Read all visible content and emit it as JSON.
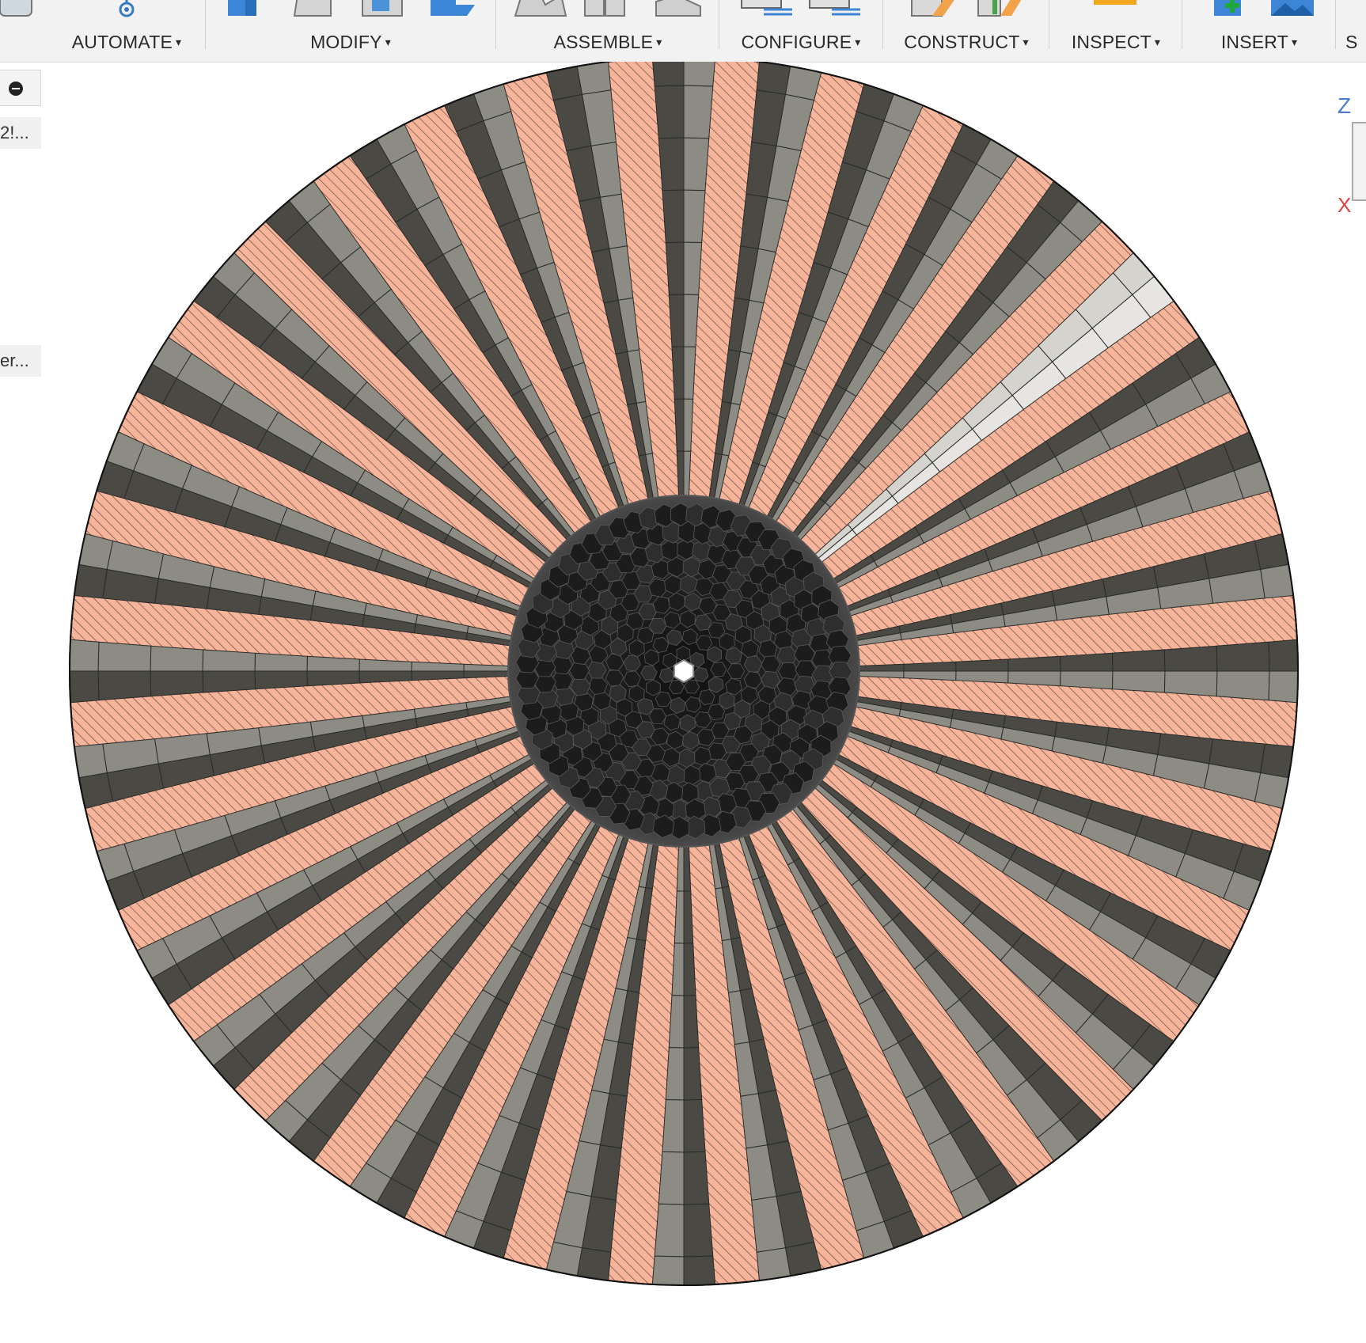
{
  "toolbar": {
    "groups": [
      {
        "label": "AUTOMATE"
      },
      {
        "label": "MODIFY"
      },
      {
        "label": "ASSEMBLE"
      },
      {
        "label": "CONFIGURE"
      },
      {
        "label": "CONSTRUCT"
      },
      {
        "label": "INSPECT"
      },
      {
        "label": "INSERT"
      },
      {
        "label": "S"
      }
    ],
    "caret": "▾"
  },
  "side_panel": {
    "tab1_text": "2!...",
    "tab2_text": "er..."
  },
  "viewcube": {
    "axis_z": "Z",
    "axis_x": "X"
  },
  "model": {
    "colors": {
      "section_fill": "#f6b49a",
      "hatch": "#3a2a22",
      "bar_dark": "#4a4944",
      "bar_light": "#8c8b84",
      "core": "#1e1e1e",
      "highlight_bar": "#d4d3ce"
    },
    "spoke_count": 36
  }
}
